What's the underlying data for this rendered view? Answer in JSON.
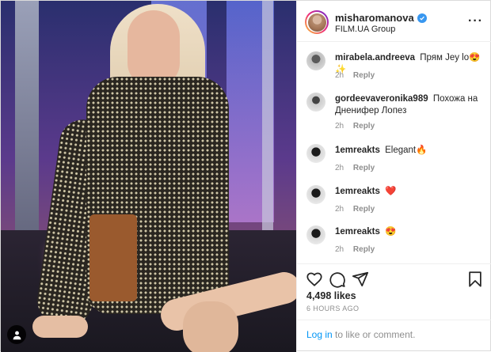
{
  "post": {
    "author": {
      "username": "misharomanova",
      "verified": true,
      "location": "FILM.UA Group"
    },
    "more_icon": "ellipsis-icon",
    "photo": {
      "tag_icon": "user-tag-icon"
    },
    "comments": [
      {
        "username": "mirabela.andreeva",
        "text": "Прям Jey lo😍✨",
        "time": "2h",
        "reply": "Reply"
      },
      {
        "username": "gordeevaveronika989",
        "text": "Похожа на Дненифер Лопез",
        "time": "2h",
        "reply": "Reply"
      },
      {
        "username": "1emreakts",
        "text": "Elegant🔥",
        "time": "2h",
        "reply": "Reply"
      },
      {
        "username": "1emreakts",
        "text": "❤️",
        "time": "2h",
        "reply": "Reply"
      },
      {
        "username": "1emreakts",
        "text": "😍",
        "time": "2h",
        "reply": "Reply"
      }
    ],
    "actions": {
      "like_icon": "heart-icon",
      "comment_icon": "comment-icon",
      "share_icon": "share-icon",
      "save_icon": "bookmark-icon"
    },
    "likes": "4,498 likes",
    "timestamp": "6 HOURS AGO",
    "login": {
      "link": "Log in",
      "rest": " to like or comment."
    },
    "colors": {
      "link": "#0095f6",
      "verified": "#3897f0",
      "text": "#262626",
      "muted": "#8e8e8e"
    }
  }
}
